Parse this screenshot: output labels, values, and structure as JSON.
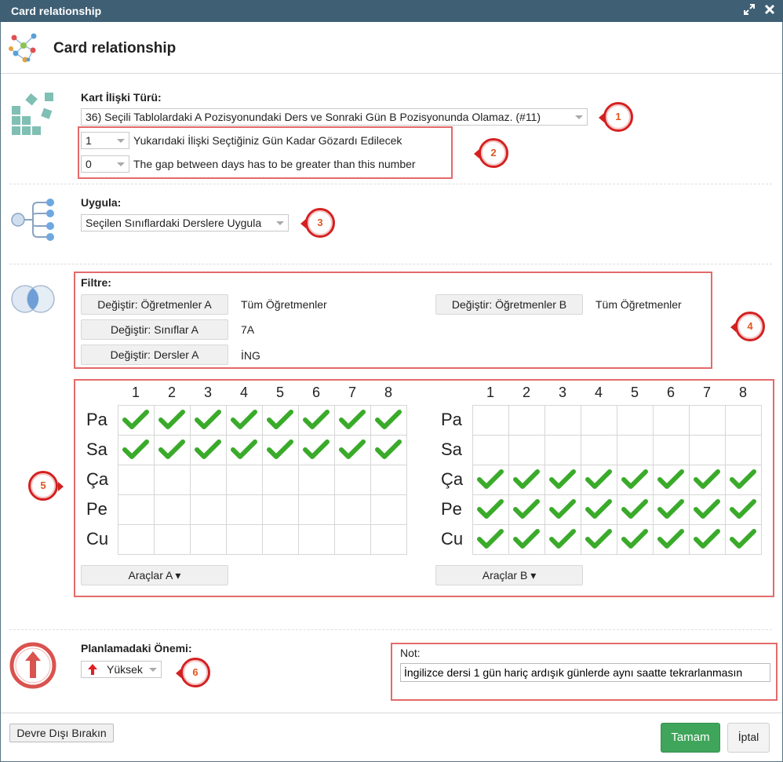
{
  "window": {
    "title": "Card relationship"
  },
  "header": {
    "title": "Card relationship"
  },
  "relation": {
    "label": "Kart İlişki Türü:",
    "type_value": "36) Seçili Tablolardaki A Pozisyonundaki Ders ve Sonraki Gün B Pozisyonunda Olamaz. (#11)",
    "param1": {
      "value": "1",
      "text": "Yukarıdaki İlişki Seçtiğiniz Gün Kadar Gözardı Edilecek"
    },
    "param2": {
      "value": "0",
      "text": "The gap between days has to be greater than this number"
    }
  },
  "apply": {
    "label": "Uygula:",
    "value": "Seçilen Sınıflardaki Derslere Uygula"
  },
  "filter": {
    "label": "Filtre:",
    "teachers_a_button": "Değiştir: Öğretmenler A",
    "teachers_a_value": "Tüm Öğretmenler",
    "teachers_b_button": "Değiştir: Öğretmenler B",
    "teachers_b_value": "Tüm Öğretmenler",
    "classes_a_button": "Değiştir: Sınıflar A",
    "classes_a_value": "7A",
    "subjects_a_button": "Değiştir: Dersler A",
    "subjects_a_value": "İNG"
  },
  "grids": {
    "periods": [
      "1",
      "2",
      "3",
      "4",
      "5",
      "6",
      "7",
      "8"
    ],
    "days": [
      "Pa",
      "Sa",
      "Ça",
      "Pe",
      "Cu"
    ],
    "a": {
      "checked": [
        [
          1,
          1,
          1,
          1,
          1,
          1,
          1,
          1
        ],
        [
          1,
          1,
          1,
          1,
          1,
          1,
          1,
          1
        ],
        [
          0,
          0,
          0,
          0,
          0,
          0,
          0,
          0
        ],
        [
          0,
          0,
          0,
          0,
          0,
          0,
          0,
          0
        ],
        [
          0,
          0,
          0,
          0,
          0,
          0,
          0,
          0
        ]
      ],
      "tools_label": "Araçlar A ▾"
    },
    "b": {
      "checked": [
        [
          0,
          0,
          0,
          0,
          0,
          0,
          0,
          0
        ],
        [
          0,
          0,
          0,
          0,
          0,
          0,
          0,
          0
        ],
        [
          1,
          1,
          1,
          1,
          1,
          1,
          1,
          1
        ],
        [
          1,
          1,
          1,
          1,
          1,
          1,
          1,
          1
        ],
        [
          1,
          1,
          1,
          1,
          1,
          1,
          1,
          1
        ]
      ],
      "tools_label": "Araçlar B ▾"
    }
  },
  "importance": {
    "label": "Planlamadaki Önemi:",
    "value": "Yüksek"
  },
  "note": {
    "label": "Not:",
    "value": "İngilizce dersi 1 gün hariç ardışık günlerde aynı saatte tekrarlanmasın"
  },
  "footer": {
    "disable_button": "Devre Dışı Bırakın",
    "ok_button": "Tamam",
    "cancel_button": "İptal"
  },
  "callouts": [
    "1",
    "2",
    "3",
    "4",
    "5",
    "6"
  ],
  "colors": {
    "titlebar": "#3f5f74",
    "check": "#3aaa2a",
    "callout_border": "#d42020",
    "callout_text": "#e2541f",
    "ok": "#3fa55a",
    "highlight": "#e46a6a"
  }
}
